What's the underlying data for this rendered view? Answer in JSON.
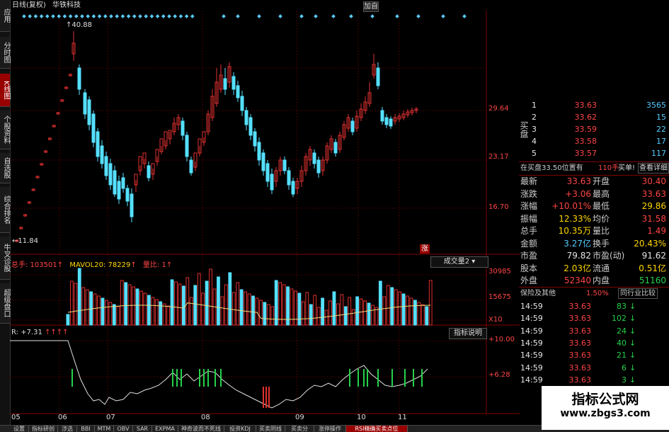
{
  "title": {
    "period": "日线(复权)",
    "stock": "华铁科技",
    "add_btn": "加自"
  },
  "side_tabs": [
    {
      "label": "应用",
      "active": false
    },
    {
      "label": "分时图",
      "active": false
    },
    {
      "label": "K线图",
      "active": true
    },
    {
      "label": "个股资料",
      "active": false
    },
    {
      "label": "自选股",
      "active": false
    },
    {
      "label": "综合排名",
      "active": false
    },
    {
      "label": "牛叉诊股",
      "active": false
    },
    {
      "label": "超级盘口",
      "active": false
    }
  ],
  "price_chart": {
    "high_marker": "40.88",
    "low_marker": "11.84",
    "axis_labels": [
      "29.64",
      "23.17",
      "16.70"
    ],
    "zhang_tag": "涨"
  },
  "volume_pane": {
    "total": "总手: 103501",
    "mavol": "MAVOL20: 78229",
    "ratio": "量比: 1",
    "selector": "成交量2",
    "axis_labels": [
      "30985",
      "15675",
      "X10"
    ]
  },
  "indicator_pane": {
    "value": "R: +7.31",
    "explain_btn": "指标说明",
    "axis_labels": [
      "+10.00",
      "+6.28"
    ]
  },
  "x_labels": [
    "05",
    "06",
    "07",
    "08",
    "09",
    "10",
    "11"
  ],
  "order_book": [
    {
      "level": "1",
      "price": "33.63",
      "vol": "3565"
    },
    {
      "level": "2",
      "price": "33.62",
      "vol": "15"
    },
    {
      "level": "3",
      "price": "33.59",
      "vol": "22"
    },
    {
      "level": "4",
      "price": "33.58",
      "vol": "17"
    },
    {
      "level": "5",
      "price": "33.57",
      "vol": "117"
    }
  ],
  "buy_side_label": "买盘",
  "queue_note": "在买盘33.50位置有",
  "queue_count": "110手",
  "queue_buy": "买单!",
  "queue_view": "查看详细",
  "quote_rows": [
    {
      "l1": "最新",
      "v1": "33.63",
      "c1": "red",
      "l2": "开盘",
      "v2": "30.40",
      "c2": "red"
    },
    {
      "l1": "涨跌",
      "v1": "+3.06",
      "c1": "red",
      "l2": "最高",
      "v2": "33.63",
      "c2": "red"
    },
    {
      "l1": "涨幅",
      "v1": "+10.01%",
      "c1": "red",
      "l2": "最低",
      "v2": "29.86",
      "c2": "yel"
    },
    {
      "l1": "振幅",
      "v1": "12.33%",
      "c1": "yel",
      "l2": "均价",
      "v2": "31.58",
      "c2": "red"
    },
    {
      "l1": "总手",
      "v1": "10.35万",
      "c1": "yel",
      "l2": "量比",
      "v2": "1.49",
      "c2": "red"
    },
    {
      "l1": "金额",
      "v1": "3.27亿",
      "c1": "cyan",
      "l2": "换手",
      "v2": "20.43%",
      "c2": "yel"
    },
    {
      "l1": "市盈",
      "v1": "79.82",
      "c1": "wht",
      "l2": "市盈(动)",
      "v2": "91.62",
      "c2": "wht"
    },
    {
      "l1": "股本",
      "v1": "2.03亿",
      "c1": "yel",
      "l2": "流通",
      "v2": "0.51亿",
      "c2": "yel"
    },
    {
      "l1": "外盘",
      "v1": "52340",
      "c1": "red",
      "l2": "内盘",
      "v2": "51160",
      "c2": "grn"
    }
  ],
  "sector": {
    "name": "保险及其他",
    "pct": "1.50%",
    "compare_btn": "同行业比较"
  },
  "ticks": [
    {
      "time": "14:59",
      "price": "33.63",
      "vol": "83",
      "dir": "down"
    },
    {
      "time": "14:59",
      "price": "33.63",
      "vol": "102",
      "dir": "down"
    },
    {
      "time": "14:59",
      "price": "33.63",
      "vol": "24",
      "dir": "down"
    },
    {
      "time": "14:59",
      "price": "33.63",
      "vol": "40",
      "dir": "down"
    },
    {
      "time": "14:59",
      "price": "33.63",
      "vol": "21",
      "dir": "down"
    },
    {
      "time": "14:59",
      "price": "33.63",
      "vol": "6",
      "dir": "down"
    },
    {
      "time": "14:59",
      "price": "33.63",
      "vol": "3",
      "dir": "down"
    }
  ],
  "bottom_tabs": [
    {
      "label": "设置",
      "active": false
    },
    {
      "label": "指标研创",
      "active": false
    },
    {
      "label": "涉选",
      "active": false
    },
    {
      "label": "BBI",
      "active": false
    },
    {
      "label": "MTM",
      "active": false
    },
    {
      "label": "OBV",
      "active": false
    },
    {
      "label": "SAR",
      "active": false
    },
    {
      "label": "EXPMA",
      "active": false
    },
    {
      "label": "神奇波而不死线",
      "active": false
    },
    {
      "label": "投资KDJ",
      "active": false
    },
    {
      "label": "买卖阴线",
      "active": false
    },
    {
      "label": "买卖分",
      "active": false
    },
    {
      "label": "涨停操作",
      "active": false
    },
    {
      "label": "RSI精确买卖点位",
      "active": true
    }
  ],
  "watermark": {
    "line1": "指标公式网",
    "line2": "www.zbgs3.com"
  },
  "colors": {
    "up": "#e03030",
    "down": "#55e0ff",
    "ma": "#e8e080",
    "grid": "#800000"
  }
}
